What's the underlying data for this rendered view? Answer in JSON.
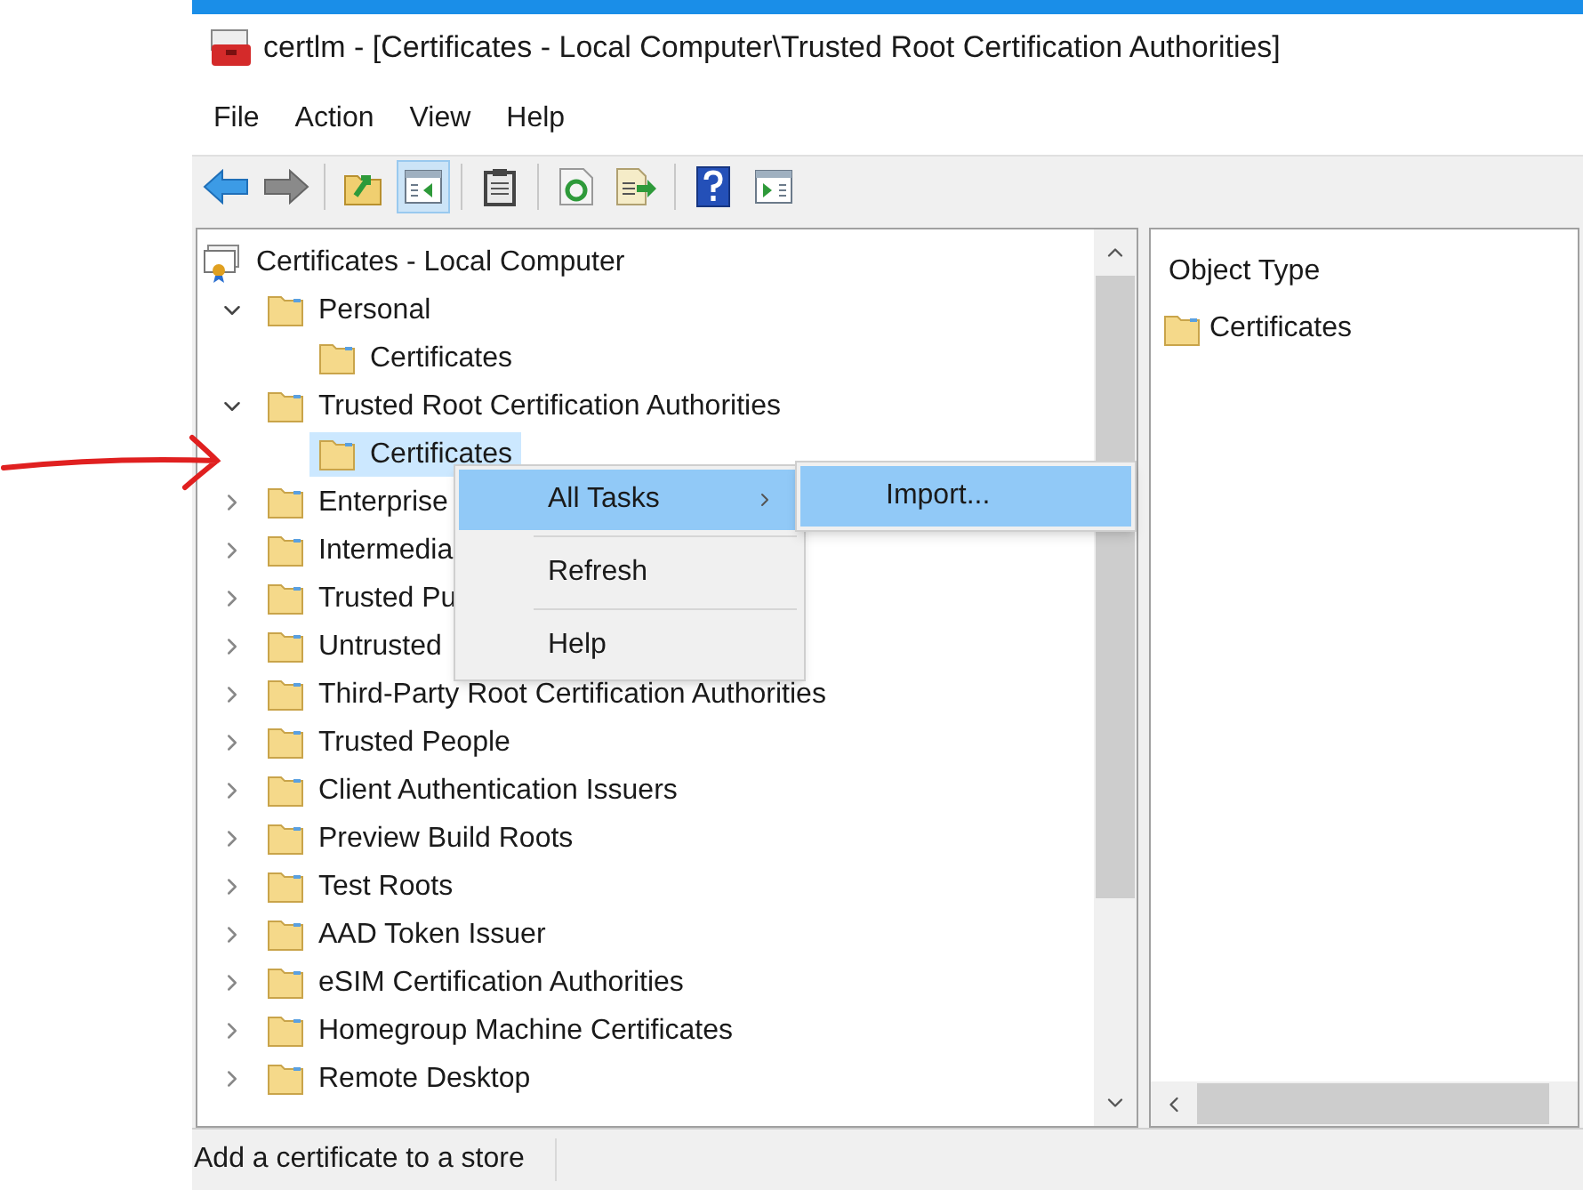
{
  "window": {
    "title": "certlm - [Certificates - Local Computer\\Trusted Root Certification Authorities]"
  },
  "menubar": [
    {
      "label": "File"
    },
    {
      "label": "Action"
    },
    {
      "label": "View"
    },
    {
      "label": "Help"
    }
  ],
  "toolbar": [
    {
      "kind": "back",
      "pressed": false
    },
    {
      "kind": "forward",
      "pressed": false
    },
    {
      "kind": "separator"
    },
    {
      "kind": "up",
      "pressed": false
    },
    {
      "kind": "tree",
      "pressed": true
    },
    {
      "kind": "separator"
    },
    {
      "kind": "clipboard",
      "pressed": false
    },
    {
      "kind": "separator"
    },
    {
      "kind": "refresh",
      "pressed": false
    },
    {
      "kind": "export",
      "pressed": false
    },
    {
      "kind": "separator"
    },
    {
      "kind": "help",
      "pressed": false
    },
    {
      "kind": "panel",
      "pressed": false
    }
  ],
  "tree": {
    "label": "Certificates - Local Computer",
    "children": [
      {
        "label": "Personal",
        "expanded": true,
        "selected": false,
        "children": [
          {
            "label": "Certificates",
            "selected": false
          }
        ]
      },
      {
        "label": "Trusted Root Certification Authorities",
        "expanded": true,
        "selected": false,
        "children": [
          {
            "label": "Certificates",
            "selected": true
          }
        ]
      },
      {
        "label": "Enterprise",
        "expanded": false,
        "selected": false
      },
      {
        "label": "Intermedia",
        "expanded": false,
        "selected": false
      },
      {
        "label": "Trusted Pu",
        "expanded": false,
        "selected": false
      },
      {
        "label": "Untrusted",
        "expanded": false,
        "selected": false
      },
      {
        "label": "Third-Party Root Certification Authorities",
        "expanded": false,
        "selected": false
      },
      {
        "label": "Trusted People",
        "expanded": false,
        "selected": false
      },
      {
        "label": "Client Authentication Issuers",
        "expanded": false,
        "selected": false
      },
      {
        "label": "Preview Build Roots",
        "expanded": false,
        "selected": false
      },
      {
        "label": "Test Roots",
        "expanded": false,
        "selected": false
      },
      {
        "label": "AAD Token Issuer",
        "expanded": false,
        "selected": false
      },
      {
        "label": "eSIM Certification Authorities",
        "expanded": false,
        "selected": false
      },
      {
        "label": "Homegroup Machine Certificates",
        "expanded": false,
        "selected": false
      },
      {
        "label": "Remote Desktop",
        "expanded": false,
        "selected": false
      }
    ]
  },
  "context_menu": {
    "items": [
      {
        "kind": "item",
        "label": "All Tasks",
        "submenu": true,
        "highlighted": true
      },
      {
        "kind": "separator"
      },
      {
        "kind": "item",
        "label": "Refresh",
        "submenu": false,
        "highlighted": false
      },
      {
        "kind": "separator"
      },
      {
        "kind": "item",
        "label": "Help",
        "submenu": false,
        "highlighted": false
      }
    ],
    "submenu": [
      {
        "label": "Import...",
        "highlighted": true
      }
    ]
  },
  "details": {
    "column": "Object Type",
    "items": [
      {
        "label": "Certificates"
      }
    ]
  },
  "status_bar": "Add a certificate to a store"
}
